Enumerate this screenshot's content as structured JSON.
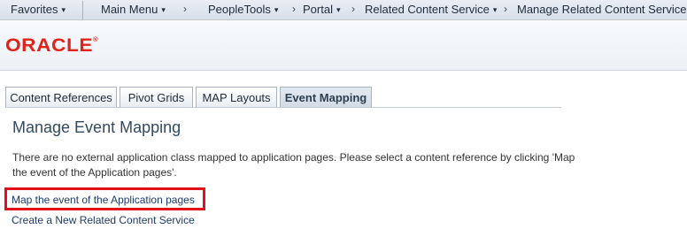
{
  "topnav": {
    "items": [
      {
        "label": "Favorites"
      },
      {
        "label": "Main Menu"
      },
      {
        "label": "PeopleTools"
      },
      {
        "label": "Portal"
      },
      {
        "label": "Related Content Service"
      },
      {
        "label": "Manage Related Content Service"
      }
    ],
    "caret_glyph": "▾",
    "arrow_glyph": "›"
  },
  "branding": {
    "logo_text": "ORACLE",
    "logo_mark": "®",
    "logo_color": "#e0241b"
  },
  "tabs": [
    {
      "label": "Content References",
      "active": false
    },
    {
      "label": "Pivot Grids",
      "active": false
    },
    {
      "label": "MAP Layouts",
      "active": false
    },
    {
      "label": "Event Mapping",
      "active": true
    }
  ],
  "main": {
    "title": "Manage Event Mapping",
    "message": "There are no external application class mapped to application pages.  Please select a content reference by clicking 'Map the event of the Application pages'.",
    "links": {
      "map_event": "Map the event of the Application pages",
      "create_service": "Create a New Related Content Service"
    },
    "highlight_color": "#e3101b"
  }
}
